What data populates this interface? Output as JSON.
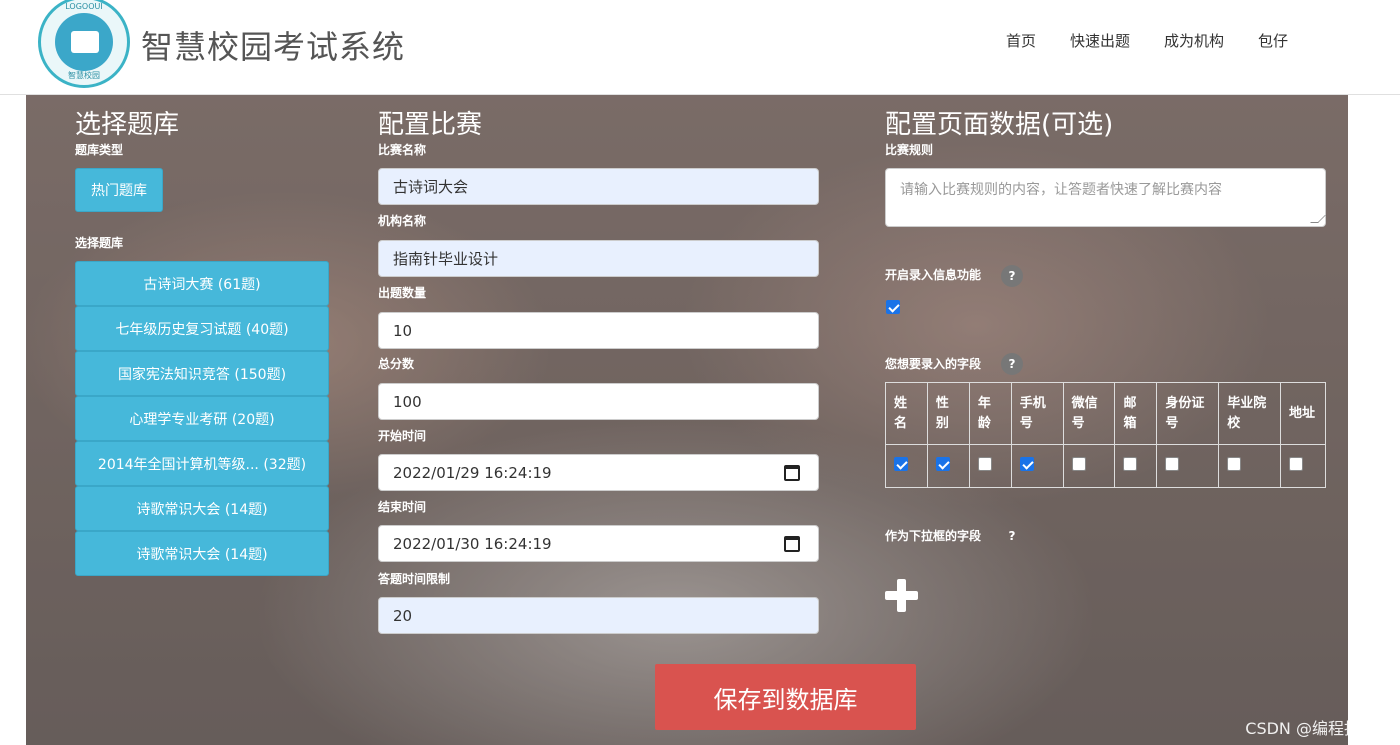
{
  "header": {
    "brand": "智慧校园考试系统",
    "logo_text_top": "LOGOOUI",
    "logo_text_bottom": "智慧校园",
    "nav": [
      "首页",
      "快速出题",
      "成为机构",
      "包仔"
    ]
  },
  "left": {
    "title": "选择题库",
    "type_label": "题库类型",
    "hot_button": "热门题库",
    "select_label": "选择题库",
    "banks": [
      "古诗词大赛 (61题)",
      "七年级历史复习试题 (40题)",
      "国家宪法知识竞答 (150题)",
      "心理学专业考研 (20题)",
      "2014年全国计算机等级... (32题)",
      "诗歌常识大会 (14题)",
      "诗歌常识大会 (14题)"
    ]
  },
  "middle": {
    "title": "配置比赛",
    "name_label": "比赛名称",
    "name_value": "古诗词大会",
    "org_label": "机构名称",
    "org_value": "指南针毕业设计",
    "count_label": "出题数量",
    "count_value": "10",
    "score_label": "总分数",
    "score_value": "100",
    "start_label": "开始时间",
    "start_value": "2022/01/29 16:24:19",
    "end_label": "结束时间",
    "end_value": "2022/01/30 16:24:19",
    "limit_label": "答题时间限制",
    "limit_value": "20"
  },
  "right": {
    "title": "配置页面数据(可选)",
    "rules_label": "比赛规则",
    "rules_placeholder": "请输入比赛规则的内容，让答题者快速了解比赛内容",
    "enable_label": "开启录入信息功能",
    "enable_checked": true,
    "fields_label": "您想要录入的字段",
    "fields": [
      {
        "label": "姓名",
        "checked": true
      },
      {
        "label": "性别",
        "checked": true
      },
      {
        "label": "年龄",
        "checked": false
      },
      {
        "label": "手机号",
        "checked": true
      },
      {
        "label": "微信号",
        "checked": false
      },
      {
        "label": "邮箱",
        "checked": false
      },
      {
        "label": "身份证号",
        "checked": false
      },
      {
        "label": "毕业院校",
        "checked": false
      },
      {
        "label": "地址",
        "checked": false
      }
    ],
    "dropdown_label": "作为下拉框的字段",
    "help_symbol": "?"
  },
  "save_button": "保存到数据库",
  "watermark": "CSDN @编程指南针",
  "colors": {
    "accent_blue": "#46b8da",
    "danger": "#d9534f",
    "checkbox": "#1a73e8"
  }
}
